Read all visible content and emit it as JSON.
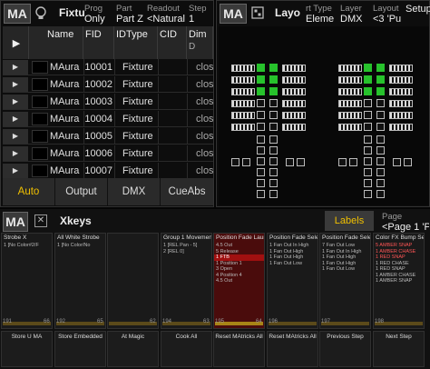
{
  "fixture_window": {
    "ma_badge": "MA",
    "title": "Fixtu",
    "header": [
      {
        "label": "Prog",
        "value": "Only"
      },
      {
        "label": "Part",
        "value": "Part Z"
      },
      {
        "label": "Readout",
        "value": "<Natural"
      },
      {
        "label": "Step",
        "value": "1"
      }
    ],
    "columns": [
      "Name",
      "FID",
      "IDType",
      "CID",
      "Dim"
    ],
    "dim_sub": "D",
    "rows": [
      {
        "name": "MAura",
        "fid": "10001",
        "idtype": "Fixture",
        "dim": "clos"
      },
      {
        "name": "MAura",
        "fid": "10002",
        "idtype": "Fixture",
        "dim": "clos"
      },
      {
        "name": "MAura",
        "fid": "10003",
        "idtype": "Fixture",
        "dim": "clos"
      },
      {
        "name": "MAura",
        "fid": "10004",
        "idtype": "Fixture",
        "dim": "clos"
      },
      {
        "name": "MAura",
        "fid": "10005",
        "idtype": "Fixture",
        "dim": "clos"
      },
      {
        "name": "MAura",
        "fid": "10006",
        "idtype": "Fixture",
        "dim": "clos"
      },
      {
        "name": "MAura",
        "fid": "10007",
        "idtype": "Fixture",
        "dim": "clos"
      }
    ],
    "tabs": [
      "Auto",
      "Output",
      "DMX",
      "CueAbs"
    ],
    "active_tab_color": "#f0c000"
  },
  "layout_window": {
    "ma_badge": "MA",
    "title": "Layo",
    "header": [
      {
        "label": "rt Type",
        "value": "Eleme"
      },
      {
        "label": "Layer",
        "value": "DMX"
      },
      {
        "label": "Layout",
        "value": "<3 'Pu"
      },
      {
        "label": "",
        "value": "Setup"
      }
    ]
  },
  "xkeys_window": {
    "ma_badge": "MA",
    "title": "Xkeys",
    "labels_button": "Labels",
    "page_label": "Page",
    "page_value": "<Page 1 'Pu",
    "executors": [
      {
        "title": "Strobe X",
        "lines": [
          "1 [No Color#2/F"
        ],
        "num_left": "191",
        "num_right": "66"
      },
      {
        "title": "All White Strobe",
        "lines": [
          "1 [No Color/No"
        ],
        "num_left": "192",
        "num_right": "65"
      },
      {
        "title": "",
        "lines": [],
        "num_left": "",
        "num_right": "62"
      },
      {
        "title": "Group 1 Movement",
        "lines": [
          "1 [REL Pan - 5]",
          "2 [REL 0]"
        ],
        "num_left": "194",
        "num_right": "63"
      },
      {
        "title": "Position Fade Launc",
        "lines": [
          "4.5 Out",
          "5 Release",
          "1 FTB",
          "1 Position 1",
          "3 Open",
          "4 Position 4",
          "4.5 Out"
        ],
        "num_left": "195",
        "num_right": "64"
      },
      {
        "title": "Position Fade Selec",
        "lines": [
          "1 Fan Out In High",
          "1 Fan Out High",
          "1 Fan Out High",
          "1 Fan Out Low"
        ],
        "num_left": "196",
        "num_right": ""
      },
      {
        "title": "Position Fade Selec",
        "lines": [
          "7 Fan Out Low",
          "1 Fan Out In High",
          "1 Fan Out High",
          "1 Fan Out High",
          "1 Fan Out Low"
        ],
        "num_left": "197",
        "num_right": ""
      },
      {
        "title": "Color FX Bump Sele",
        "lines": [
          "5 AMBER SNAP",
          "1 AMBER CHASE",
          "1 RED SNAP",
          "1 RED CHASE",
          "1 RED SNAP",
          "1 AMBER CHASE",
          "1 AMBER SNAP"
        ],
        "num_left": "198",
        "num_right": ""
      }
    ],
    "bottom_buttons": [
      "Store U MA",
      "Store Embedded",
      "At Magic",
      "Cook All",
      "Reset MAtricks All",
      "Reset MAtricks All",
      "Previous Step",
      "Next Step"
    ]
  }
}
